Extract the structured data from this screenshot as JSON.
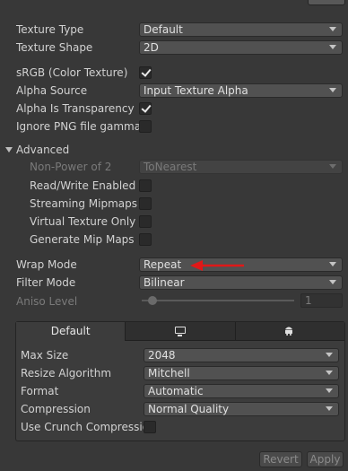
{
  "top_button": "",
  "rows": {
    "texture_type": {
      "label": "Texture Type",
      "value": "Default"
    },
    "texture_shape": {
      "label": "Texture Shape",
      "value": "2D"
    },
    "srgb": {
      "label": "sRGB (Color Texture)",
      "checked": true
    },
    "alpha_source": {
      "label": "Alpha Source",
      "value": "Input Texture Alpha"
    },
    "alpha_is_transparency": {
      "label": "Alpha Is Transparency",
      "checked": true
    },
    "ignore_png_gamma": {
      "label": "Ignore PNG file gamma",
      "checked": false
    }
  },
  "advanced": {
    "title": "Advanced",
    "non_power_of_2": {
      "label": "Non-Power of 2",
      "value": "ToNearest"
    },
    "read_write": {
      "label": "Read/Write Enabled",
      "checked": false
    },
    "streaming_mipmaps": {
      "label": "Streaming Mipmaps",
      "checked": false
    },
    "virtual_texture_only": {
      "label": "Virtual Texture Only",
      "checked": false
    },
    "generate_mip_maps": {
      "label": "Generate Mip Maps",
      "checked": false
    }
  },
  "wrap_mode": {
    "label": "Wrap Mode",
    "value": "Repeat"
  },
  "filter_mode": {
    "label": "Filter Mode",
    "value": "Bilinear"
  },
  "aniso_level": {
    "label": "Aniso Level",
    "value": "1"
  },
  "platform_tabs": [
    {
      "label": "Default",
      "icon": null
    },
    {
      "label": "",
      "icon": "monitor-icon"
    },
    {
      "label": "",
      "icon": "android-icon"
    }
  ],
  "platform": {
    "max_size": {
      "label": "Max Size",
      "value": "2048"
    },
    "resize_algorithm": {
      "label": "Resize Algorithm",
      "value": "Mitchell"
    },
    "format": {
      "label": "Format",
      "value": "Automatic"
    },
    "compression": {
      "label": "Compression",
      "value": "Normal Quality"
    },
    "crunch": {
      "label": "Use Crunch Compressio",
      "checked": false
    }
  },
  "buttons": {
    "revert": "Revert",
    "apply": "Apply"
  },
  "colors": {
    "background": "#383838",
    "annotation_arrow": "#e01818"
  }
}
